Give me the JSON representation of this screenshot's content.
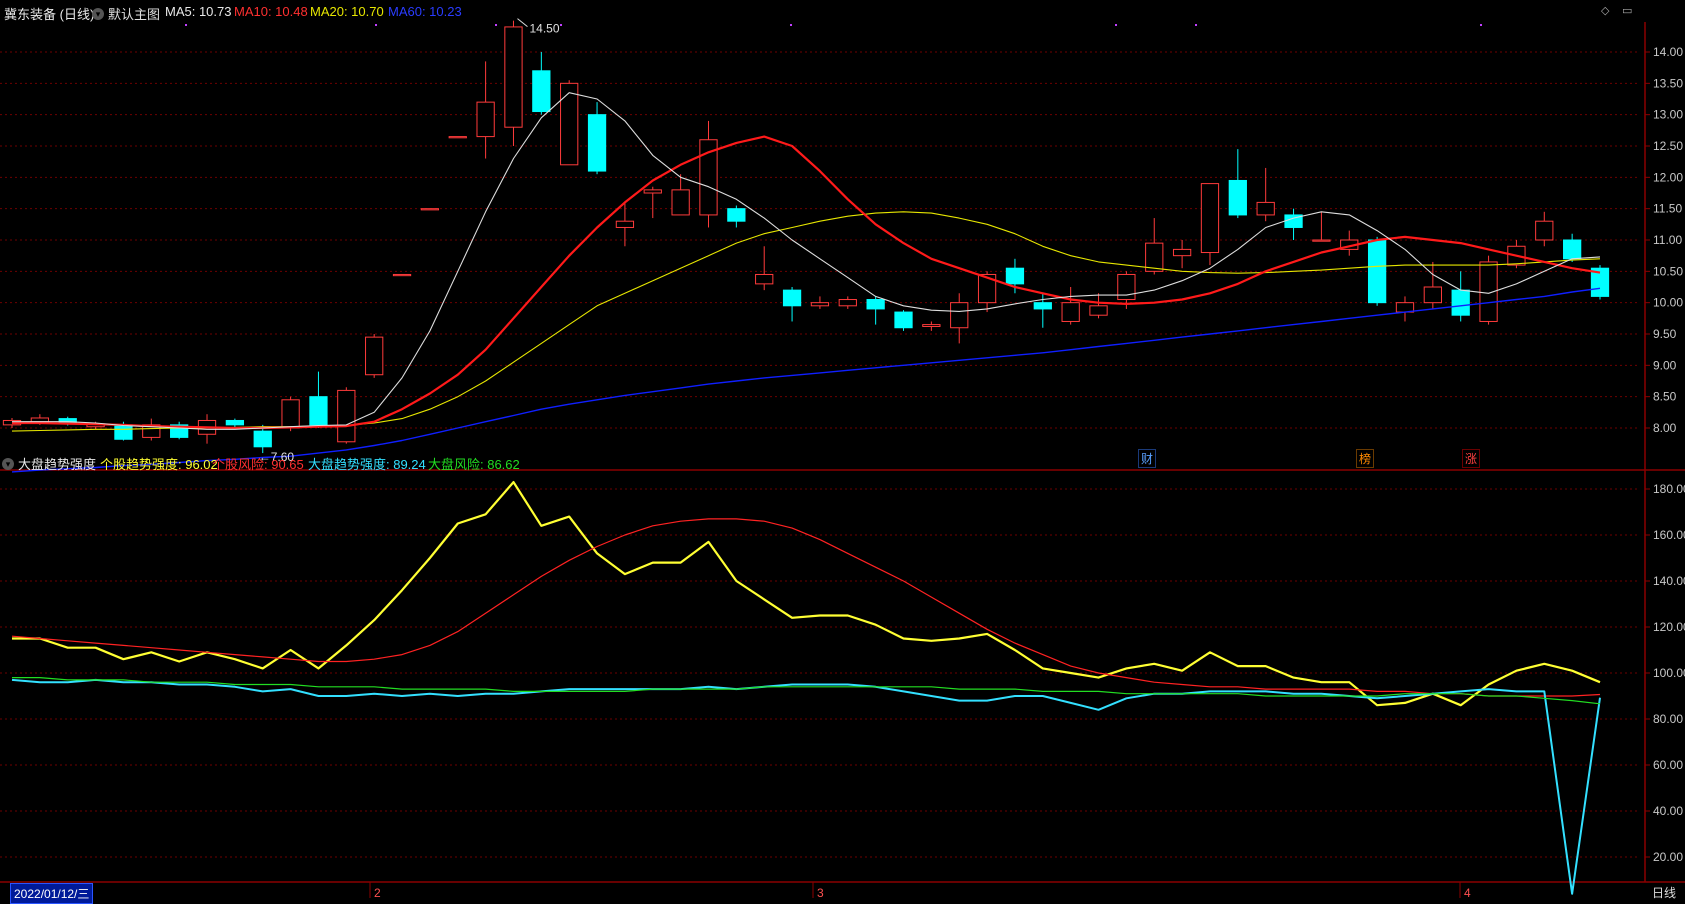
{
  "header": {
    "stock_name": "冀东装备 (日线)",
    "main_chart_label": "默认主图",
    "ma5": "MA5: 10.73",
    "ma10": "MA10: 10.48",
    "ma20": "MA20: 10.70",
    "ma60": "MA60: 10.23"
  },
  "indicator_header": {
    "name": "大盘趋势强度",
    "stock_trend": "个股趋势强度: 96.02",
    "stock_risk": "个股风险: 90.65",
    "market_trend": "大盘趋势强度: 89.24",
    "market_risk": "大盘风险: 86.62"
  },
  "annotations": {
    "high": "14.50",
    "low": "7.60"
  },
  "event_tags": [
    "财",
    "榜",
    "涨"
  ],
  "footer": {
    "cursor_date": "2022/01/12/三",
    "months": [
      "2",
      "3",
      "4"
    ],
    "period": "日线"
  },
  "colors": {
    "up": "#ff3b3b",
    "down": "#00ffff",
    "ma5": "#dddddd",
    "ma10": "#ff1a1a",
    "ma20": "#e6e600",
    "ma60": "#0f1fff",
    "axis": "#8b0000",
    "grid": "#6e0000"
  },
  "chart_data": [
    {
      "type": "candlestick",
      "title": "冀东装备 (日线)",
      "ylim": [
        7.2,
        14.6
      ],
      "yticks": [
        "8.00",
        "8.50",
        "9.00",
        "9.50",
        "10.00",
        "10.50",
        "11.00",
        "11.50",
        "12.00",
        "12.50",
        "13.00",
        "13.50",
        "14.00"
      ],
      "candles": [
        {
          "o": 8.05,
          "c": 8.12,
          "h": 8.16,
          "l": 8.0
        },
        {
          "o": 8.1,
          "c": 8.16,
          "h": 8.22,
          "l": 8.05
        },
        {
          "o": 8.15,
          "c": 8.08,
          "h": 8.18,
          "l": 8.04
        },
        {
          "o": 8.02,
          "c": 8.06,
          "h": 8.1,
          "l": 7.98
        },
        {
          "o": 8.05,
          "c": 7.82,
          "h": 8.1,
          "l": 7.8
        },
        {
          "o": 7.85,
          "c": 8.05,
          "h": 8.15,
          "l": 7.8
        },
        {
          "o": 8.05,
          "c": 7.85,
          "h": 8.1,
          "l": 7.82
        },
        {
          "o": 7.9,
          "c": 8.12,
          "h": 8.22,
          "l": 7.75
        },
        {
          "o": 8.12,
          "c": 8.05,
          "h": 8.15,
          "l": 8.0
        },
        {
          "o": 7.95,
          "c": 7.7,
          "h": 8.05,
          "l": 7.6
        },
        {
          "o": 8.0,
          "c": 8.45,
          "h": 8.5,
          "l": 7.95
        },
        {
          "o": 8.5,
          "c": 8.05,
          "h": 8.9,
          "l": 8.0
        },
        {
          "o": 7.78,
          "c": 8.6,
          "h": 8.65,
          "l": 7.75
        },
        {
          "o": 8.85,
          "c": 9.45,
          "h": 9.5,
          "l": 8.8
        },
        {
          "o": 10.45,
          "c": 10.45,
          "h": 10.45,
          "l": 10.45
        },
        {
          "o": 11.5,
          "c": 11.5,
          "h": 11.5,
          "l": 11.5
        },
        {
          "o": 12.65,
          "c": 12.65,
          "h": 12.65,
          "l": 12.65
        },
        {
          "o": 12.65,
          "c": 13.2,
          "h": 13.85,
          "l": 12.3
        },
        {
          "o": 12.8,
          "c": 14.4,
          "h": 14.5,
          "l": 12.5
        },
        {
          "o": 13.7,
          "c": 13.05,
          "h": 14.0,
          "l": 13.0
        },
        {
          "o": 12.2,
          "c": 13.5,
          "h": 13.55,
          "l": 12.2
        },
        {
          "o": 13.0,
          "c": 12.1,
          "h": 13.2,
          "l": 12.05
        },
        {
          "o": 11.2,
          "c": 11.3,
          "h": 11.6,
          "l": 10.9
        },
        {
          "o": 11.75,
          "c": 11.8,
          "h": 11.85,
          "l": 11.35
        },
        {
          "o": 11.4,
          "c": 11.8,
          "h": 12.05,
          "l": 11.4
        },
        {
          "o": 11.4,
          "c": 12.6,
          "h": 12.9,
          "l": 11.2
        },
        {
          "o": 11.5,
          "c": 11.3,
          "h": 11.55,
          "l": 11.2
        },
        {
          "o": 10.3,
          "c": 10.45,
          "h": 10.9,
          "l": 10.2
        },
        {
          "o": 10.2,
          "c": 9.95,
          "h": 10.25,
          "l": 9.7
        },
        {
          "o": 9.95,
          "c": 10.0,
          "h": 10.1,
          "l": 9.9
        },
        {
          "o": 9.95,
          "c": 10.05,
          "h": 10.1,
          "l": 9.9
        },
        {
          "o": 10.05,
          "c": 9.9,
          "h": 10.1,
          "l": 9.65
        },
        {
          "o": 9.85,
          "c": 9.6,
          "h": 9.88,
          "l": 9.55
        },
        {
          "o": 9.62,
          "c": 9.65,
          "h": 9.7,
          "l": 9.55
        },
        {
          "o": 9.6,
          "c": 10.0,
          "h": 10.15,
          "l": 9.35
        },
        {
          "o": 10.0,
          "c": 10.45,
          "h": 10.5,
          "l": 9.85
        },
        {
          "o": 10.55,
          "c": 10.3,
          "h": 10.7,
          "l": 10.15
        },
        {
          "o": 10.0,
          "c": 9.9,
          "h": 10.15,
          "l": 9.6
        },
        {
          "o": 9.7,
          "c": 10.0,
          "h": 10.25,
          "l": 9.65
        },
        {
          "o": 9.8,
          "c": 9.95,
          "h": 10.15,
          "l": 9.75
        },
        {
          "o": 10.05,
          "c": 10.45,
          "h": 10.5,
          "l": 9.9
        },
        {
          "o": 10.5,
          "c": 10.95,
          "h": 11.35,
          "l": 10.45
        },
        {
          "o": 10.75,
          "c": 10.85,
          "h": 11.0,
          "l": 10.55
        },
        {
          "o": 10.8,
          "c": 11.9,
          "h": 11.9,
          "l": 10.6
        },
        {
          "o": 11.95,
          "c": 11.4,
          "h": 12.45,
          "l": 11.35
        },
        {
          "o": 11.4,
          "c": 11.6,
          "h": 12.15,
          "l": 11.3
        },
        {
          "o": 11.4,
          "c": 11.2,
          "h": 11.5,
          "l": 11.0
        },
        {
          "o": 11.0,
          "c": 11.0,
          "h": 11.45,
          "l": 11.0
        },
        {
          "o": 10.85,
          "c": 11.0,
          "h": 11.15,
          "l": 10.75
        },
        {
          "o": 11.0,
          "c": 10.0,
          "h": 11.05,
          "l": 9.95
        },
        {
          "o": 9.85,
          "c": 10.0,
          "h": 10.1,
          "l": 9.7
        },
        {
          "o": 10.0,
          "c": 10.25,
          "h": 10.65,
          "l": 9.9
        },
        {
          "o": 10.2,
          "c": 9.8,
          "h": 10.5,
          "l": 9.7
        },
        {
          "o": 9.7,
          "c": 10.65,
          "h": 10.75,
          "l": 9.65
        },
        {
          "o": 10.6,
          "c": 10.9,
          "h": 11.0,
          "l": 10.55
        },
        {
          "o": 11.0,
          "c": 11.3,
          "h": 11.45,
          "l": 10.9
        },
        {
          "o": 11.0,
          "c": 10.7,
          "h": 11.1,
          "l": 10.65
        },
        {
          "o": 10.55,
          "c": 10.1,
          "h": 10.6,
          "l": 10.05
        }
      ],
      "ma5": [
        8.1,
        8.1,
        8.1,
        8.08,
        8.04,
        8.02,
        8.0,
        7.98,
        7.98,
        8.0,
        8.02,
        8.04,
        8.05,
        8.25,
        8.8,
        9.55,
        10.5,
        11.45,
        12.3,
        12.95,
        13.35,
        13.25,
        12.9,
        12.35,
        12.0,
        11.85,
        11.65,
        11.35,
        11.0,
        10.7,
        10.4,
        10.1,
        9.95,
        9.88,
        9.86,
        9.9,
        9.98,
        10.05,
        10.1,
        10.12,
        10.12,
        10.2,
        10.35,
        10.55,
        10.85,
        11.2,
        11.35,
        11.45,
        11.4,
        11.15,
        10.85,
        10.45,
        10.2,
        10.15,
        10.3,
        10.5,
        10.7,
        10.73
      ],
      "ma10": [
        8.08,
        8.08,
        8.07,
        8.06,
        8.05,
        8.03,
        8.02,
        8.01,
        8.0,
        8.0,
        8.01,
        8.02,
        8.03,
        8.1,
        8.3,
        8.55,
        8.85,
        9.25,
        9.75,
        10.25,
        10.75,
        11.2,
        11.6,
        11.95,
        12.2,
        12.4,
        12.55,
        12.65,
        12.5,
        12.1,
        11.65,
        11.25,
        10.95,
        10.7,
        10.55,
        10.4,
        10.25,
        10.15,
        10.05,
        10.0,
        9.98,
        10.0,
        10.05,
        10.15,
        10.3,
        10.5,
        10.65,
        10.8,
        10.9,
        11.0,
        11.05,
        11.0,
        10.95,
        10.85,
        10.75,
        10.65,
        10.55,
        10.48
      ],
      "ma20": [
        7.95,
        7.96,
        7.97,
        7.98,
        7.98,
        7.99,
        8.0,
        8.0,
        8.01,
        8.02,
        8.02,
        8.03,
        8.04,
        8.08,
        8.15,
        8.3,
        8.5,
        8.75,
        9.05,
        9.35,
        9.65,
        9.95,
        10.15,
        10.35,
        10.55,
        10.75,
        10.95,
        11.1,
        11.2,
        11.3,
        11.38,
        11.43,
        11.45,
        11.43,
        11.35,
        11.25,
        11.1,
        10.9,
        10.75,
        10.65,
        10.6,
        10.55,
        10.5,
        10.48,
        10.47,
        10.48,
        10.5,
        10.52,
        10.55,
        10.58,
        10.6,
        10.6,
        10.6,
        10.6,
        10.62,
        10.65,
        10.68,
        10.7
      ],
      "ma60": [
        7.3,
        7.33,
        7.35,
        7.37,
        7.4,
        7.42,
        7.45,
        7.48,
        7.5,
        7.53,
        7.55,
        7.6,
        7.65,
        7.72,
        7.8,
        7.9,
        8.0,
        8.1,
        8.2,
        8.3,
        8.38,
        8.45,
        8.52,
        8.58,
        8.64,
        8.7,
        8.75,
        8.8,
        8.84,
        8.88,
        8.92,
        8.96,
        9.0,
        9.04,
        9.08,
        9.12,
        9.16,
        9.2,
        9.25,
        9.3,
        9.35,
        9.4,
        9.45,
        9.5,
        9.55,
        9.6,
        9.65,
        9.7,
        9.75,
        9.8,
        9.85,
        9.9,
        9.95,
        10.0,
        10.05,
        10.1,
        10.17,
        10.23
      ]
    },
    {
      "type": "line",
      "title": "大盘趋势强度",
      "ylim": [
        0,
        190
      ],
      "yticks": [
        "20.00",
        "40.00",
        "60.00",
        "80.00",
        "100.00",
        "120.00",
        "140.00",
        "160.00",
        "180.00"
      ],
      "series": [
        {
          "name": "个股趋势强度",
          "color": "#ffff33",
          "values": [
            115,
            115,
            111,
            111,
            106,
            109,
            105,
            109,
            106,
            102,
            110,
            102,
            112,
            123,
            136,
            150,
            165,
            169,
            183,
            164,
            168,
            152,
            143,
            148,
            148,
            157,
            140,
            132,
            124,
            125,
            125,
            121,
            115,
            114,
            115,
            117,
            110,
            102,
            100,
            98,
            102,
            104,
            101,
            109,
            103,
            103,
            98,
            96,
            96,
            86,
            87,
            91,
            86,
            95,
            101,
            104,
            101,
            96
          ]
        },
        {
          "name": "个股风险",
          "color": "#ff2222",
          "values": [
            116,
            115,
            114,
            113,
            112,
            111,
            110,
            109,
            108,
            107,
            106,
            105,
            105,
            106,
            108,
            112,
            118,
            126,
            134,
            142,
            149,
            155,
            160,
            164,
            166,
            167,
            167,
            166,
            163,
            158,
            152,
            146,
            140,
            133,
            126,
            119,
            113,
            108,
            103,
            100,
            98,
            96,
            95,
            94,
            94,
            93,
            93,
            93,
            93,
            92,
            92,
            91,
            91,
            90,
            90,
            90,
            90,
            90.65
          ]
        },
        {
          "name": "大盘趋势强度",
          "color": "#33e0ff",
          "values": [
            97,
            96,
            96,
            97,
            96,
            96,
            95,
            95,
            94,
            92,
            93,
            90,
            90,
            91,
            90,
            91,
            90,
            91,
            91,
            92,
            93,
            93,
            93,
            93,
            93,
            94,
            93,
            94,
            95,
            95,
            95,
            94,
            92,
            90,
            88,
            88,
            90,
            90,
            87,
            84,
            89,
            91,
            91,
            92,
            92,
            92,
            91,
            91,
            90,
            89,
            90,
            91,
            92,
            93,
            92,
            92,
            4,
            89.24
          ]
        },
        {
          "name": "大盘风险",
          "color": "#22dd22",
          "values": [
            98,
            98,
            97,
            97,
            97,
            96,
            96,
            96,
            95,
            95,
            95,
            94,
            94,
            94,
            93,
            93,
            93,
            93,
            92,
            92,
            92,
            92,
            92,
            93,
            93,
            93,
            93,
            94,
            94,
            94,
            94,
            94,
            94,
            94,
            93,
            93,
            93,
            92,
            92,
            92,
            91,
            91,
            91,
            91,
            91,
            90,
            90,
            90,
            90,
            90,
            91,
            91,
            91,
            90,
            90,
            89,
            88,
            86.62
          ]
        }
      ]
    }
  ]
}
